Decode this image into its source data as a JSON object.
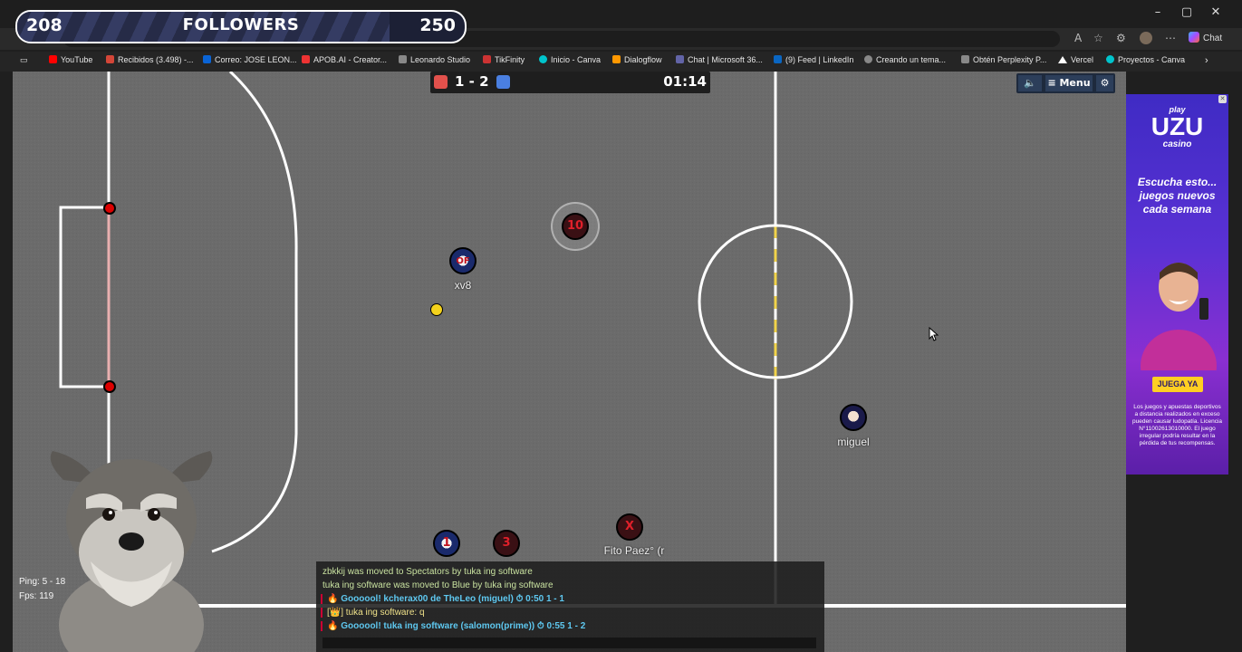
{
  "browser": {
    "window_controls": [
      "–",
      "▢",
      "✕"
    ],
    "chat_label": "Chat",
    "bookmarks": [
      {
        "label": "YouTube",
        "color": "#ff0000"
      },
      {
        "label": "Recibidos (3.498) -...",
        "color": "#d44638"
      },
      {
        "label": "Correo: JOSE LEON...",
        "color": "#0a64d6"
      },
      {
        "label": "APOB.AI - Creator...",
        "color": "#e33"
      },
      {
        "label": "Leonardo Studio",
        "color": "#888"
      },
      {
        "label": "TikFinity",
        "color": "#c33"
      },
      {
        "label": "Inicio - Canva",
        "color": "#00c4cc"
      },
      {
        "label": "Dialogflow",
        "color": "#ff9800"
      },
      {
        "label": "Chat | Microsoft 36...",
        "color": "#6264a7"
      },
      {
        "label": "(9) Feed | LinkedIn",
        "color": "#0a66c2"
      },
      {
        "label": "Creando un tema...",
        "color": "#888"
      },
      {
        "label": "Obtén Perplexity P...",
        "color": "#888"
      },
      {
        "label": "Vercel",
        "color": "#fff"
      },
      {
        "label": "Proyectos - Canva",
        "color": "#00c4cc"
      }
    ]
  },
  "followers_banner": {
    "current": "208",
    "label": "FOLLOWERS",
    "goal": "250",
    "progress": 0.832
  },
  "scoreboard": {
    "red_color": "#e2514c",
    "blue_color": "#4a7fe0",
    "score": "1 - 2",
    "time": "01:14"
  },
  "controls": {
    "sound_icon": "speaker-icon",
    "menu_label": "Menu",
    "settings_icon": "gear-icon"
  },
  "players": [
    {
      "team": "blue",
      "avatar": "OF",
      "name": "xv8"
    },
    {
      "team": "red",
      "avatar": "10",
      "name": ""
    },
    {
      "team": "blue",
      "avatar": "",
      "name": "miguel"
    },
    {
      "team": "red",
      "avatar": "X",
      "name": "Fito Paez° (r"
    },
    {
      "team": "blue",
      "avatar": "1",
      "name": ""
    },
    {
      "team": "red",
      "avatar": "3",
      "name": ""
    }
  ],
  "stats": {
    "ping": "Ping: 5 - 18",
    "fps": "Fps: 119"
  },
  "chat": {
    "messages": [
      {
        "text": "zbkkij was moved to Spectators by tuka ing software",
        "color": "#c9e2a0"
      },
      {
        "text": "tuka ing software was moved to Blue by tuka ing software",
        "color": "#c9e2a0"
      },
      {
        "text": "🔥 Goooool! kcherax00 de TheLeo (miguel)  ⏱ 0:50  1 - 1",
        "color": "#5ec8f0"
      },
      {
        "text": "[👑] tuka ing software: q",
        "color": "#f0e28a"
      },
      {
        "text": "🔥 Goooool! tuka ing software (salomon(prime))  ⏱ 0:55  1 - 2",
        "color": "#5ec8f0"
      }
    ]
  },
  "ad": {
    "brand_top": "play",
    "brand_main": "UZU",
    "brand_sub": "casino",
    "headline_1": "Escucha esto...",
    "headline_2": "juegos nuevos",
    "headline_3": "cada semana",
    "cta": "JUEGA YA",
    "disclaimer": "Los juegos y apuestas deportivos a distancia realizados en exceso pueden causar ludopatía. Licencia N°11002613010000. El juego irregular podría resultar en la pérdida de tus recompensas."
  }
}
